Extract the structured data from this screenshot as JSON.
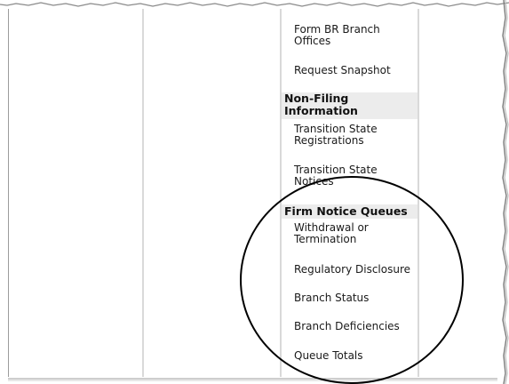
{
  "nav": {
    "items_top": [
      {
        "label": "Form BR Branch Offices"
      },
      {
        "label": "Request Snapshot"
      }
    ],
    "section_non_filing": {
      "header": "Non-Filing Information",
      "items": [
        {
          "label": "Transition State Registrations"
        },
        {
          "label": "Transition State Notices"
        }
      ]
    },
    "section_firm_notice": {
      "header": "Firm Notice Queues",
      "items": [
        {
          "label": "Withdrawal or Termination"
        },
        {
          "label": "Regulatory Disclosure"
        },
        {
          "label": "Branch Status"
        },
        {
          "label": "Branch Deficiencies"
        },
        {
          "label": "Queue Totals"
        }
      ]
    }
  },
  "colors": {
    "header_bg": "#ececec",
    "column_lines": "#d9d9d9",
    "highlight_circle": "#000000"
  }
}
